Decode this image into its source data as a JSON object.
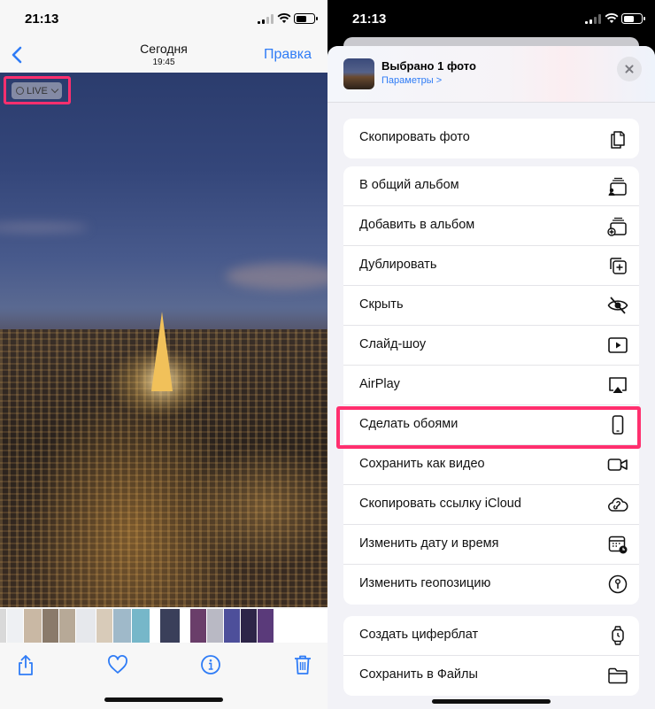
{
  "left": {
    "status": {
      "time": "21:13"
    },
    "nav": {
      "back_label": "",
      "title": "Сегодня",
      "subtitle": "19:45",
      "edit": "Правка"
    },
    "live_badge": {
      "label": "LIVE"
    }
  },
  "right": {
    "status": {
      "time": "21:13"
    },
    "sheet": {
      "title": "Выбрано 1 фото",
      "options_link": "Параметры >"
    },
    "groups": [
      [
        {
          "label": "Скопировать фото",
          "icon": "copy-icon"
        }
      ],
      [
        {
          "label": "В общий альбом",
          "icon": "shared-album-icon"
        },
        {
          "label": "Добавить в альбом",
          "icon": "add-to-album-icon"
        },
        {
          "label": "Дублировать",
          "icon": "duplicate-icon"
        },
        {
          "label": "Скрыть",
          "icon": "hide-eye-icon"
        },
        {
          "label": "Слайд-шоу",
          "icon": "slideshow-icon"
        },
        {
          "label": "AirPlay",
          "icon": "airplay-icon"
        },
        {
          "label": "Сделать обоями",
          "icon": "phone-wallpaper-icon"
        },
        {
          "label": "Сохранить как видео",
          "icon": "video-camera-icon"
        },
        {
          "label": "Скопировать ссылку iCloud",
          "icon": "icloud-link-icon"
        },
        {
          "label": "Изменить дату и время",
          "icon": "calendar-clock-icon"
        },
        {
          "label": "Изменить геопозицию",
          "icon": "location-pin-icon"
        }
      ],
      [
        {
          "label": "Создать циферблат",
          "icon": "watch-icon"
        },
        {
          "label": "Сохранить в Файлы",
          "icon": "folder-icon"
        }
      ]
    ]
  },
  "colors": {
    "accent": "#2f7cf6",
    "highlight": "#ff2f6e"
  }
}
